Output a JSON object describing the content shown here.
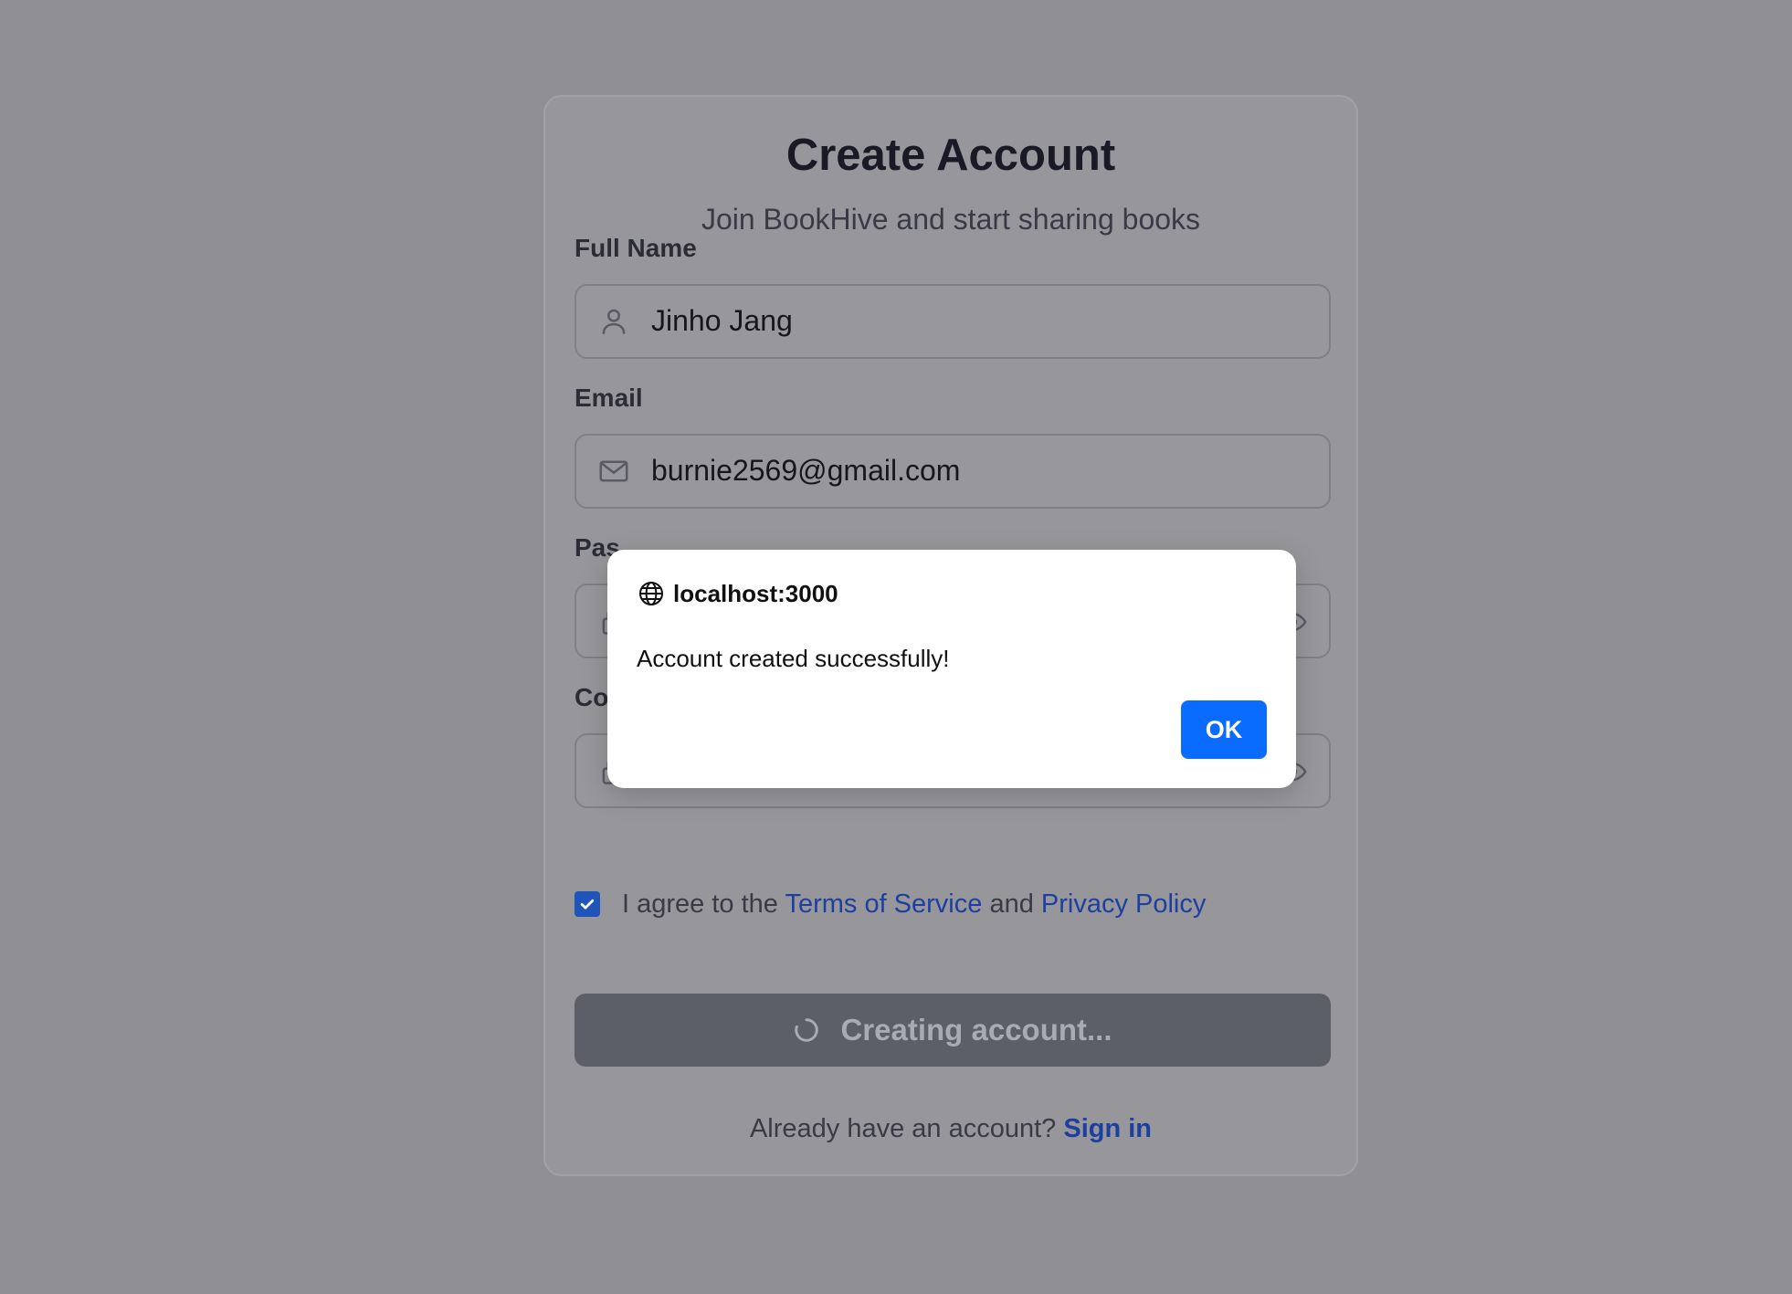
{
  "form": {
    "title": "Create Account",
    "subtitle": "Join BookHive and start sharing books",
    "full_name_label": "Full Name",
    "full_name_value": "Jinho Jang",
    "email_label": "Email",
    "email_value": "burnie2569@gmail.com",
    "password_label_visible": "Pas",
    "confirm_label_visible": "Co",
    "confirm_value": "••••••••",
    "agree_prefix": "I agree to the ",
    "terms_link": "Terms of Service",
    "agree_and": " and ",
    "privacy_link": "Privacy Policy",
    "agree_checked": true,
    "submit_label": "Creating account...",
    "signin_prefix": "Already have an account? ",
    "signin_link": "Sign in"
  },
  "dialog": {
    "origin": "localhost:3000",
    "message": "Account created successfully!",
    "ok_label": "OK"
  },
  "colors": {
    "overlay": "#8f8f94",
    "link": "#1c3fa0",
    "ok_button": "#0a6cff",
    "checkbox": "#1f55b8"
  },
  "icons": {
    "full_name": "user-icon",
    "email": "mail-icon",
    "password": "lock-icon",
    "toggle": "eye-icon",
    "dialog": "globe-icon",
    "loading": "spinner-icon"
  }
}
